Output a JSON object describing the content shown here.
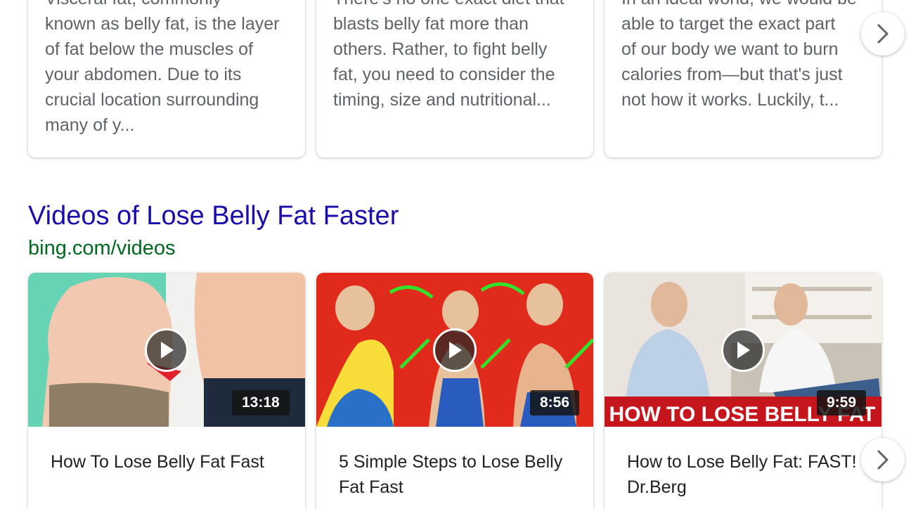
{
  "snippets": [
    {
      "text": "Visceral fat, commonly\nknown as belly fat, is the layer\nof fat below the muscles of\nyour abdomen. Due to its\ncrucial location surrounding\nmany of y..."
    },
    {
      "text": "There's no one exact diet that\nblasts belly fat more than\nothers. Rather, to fight belly\nfat, you need to consider the\ntiming, size and nutritional..."
    },
    {
      "text": "In an ideal world, we would be\nable to target the exact part\nof our body we want to burn\ncalories from—but that's just\nnot how it works. Luckily, t..."
    }
  ],
  "videos_section": {
    "title": "Videos of Lose Belly Fat Faster",
    "source": "bing.com/videos"
  },
  "videos": [
    {
      "title": "How To Lose Belly Fat Fast",
      "duration": "13:18"
    },
    {
      "title": "5 Simple Steps to Lose Belly Fat Fast",
      "duration": "8:56"
    },
    {
      "title": "How to Lose Belly Fat: FAST! Dr.Berg",
      "duration": "9:59",
      "banner": "HOW TO LOSE BELLY FAT"
    }
  ],
  "icons": {
    "carousel_next": "chevron-right-icon",
    "play": "play-icon"
  },
  "colors": {
    "link_title": "#1a0dab",
    "source_url": "#006621",
    "snippet_text": "#5f6368"
  }
}
